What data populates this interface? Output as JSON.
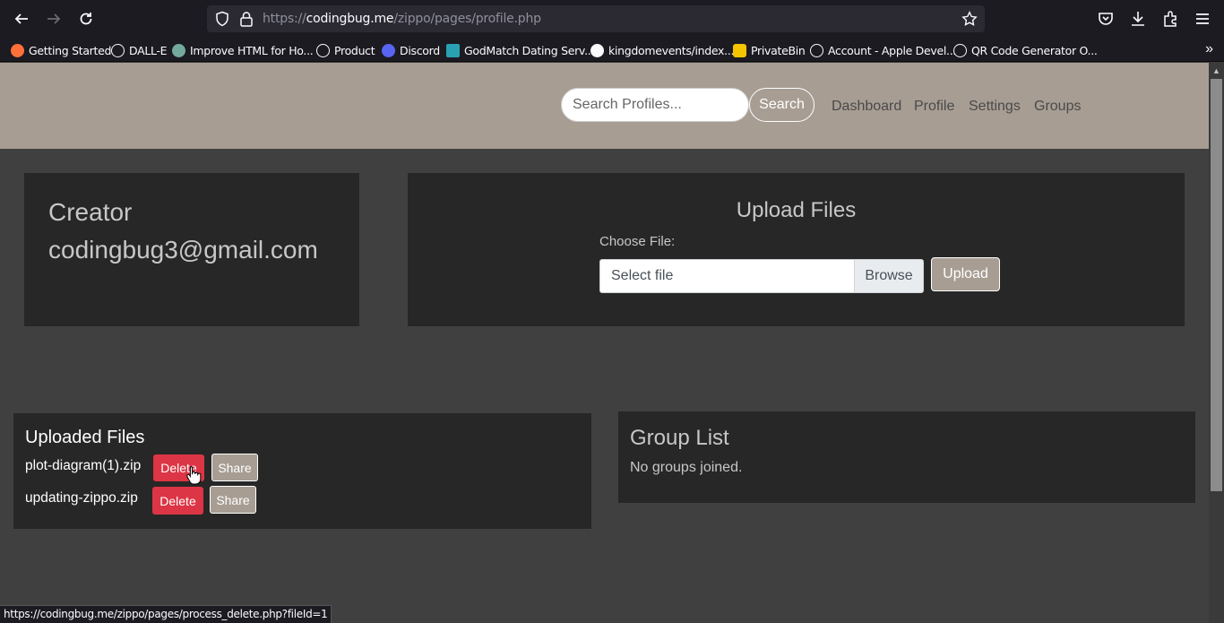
{
  "browser": {
    "url_prefix": "https://",
    "url_host": "codingbug.me",
    "url_path": "/zippo/pages/profile.php",
    "status_url": "https://codingbug.me/zippo/pages/process_delete.php?fileId=1",
    "bookmarks": [
      {
        "label": "Getting Started",
        "icon": "firefox-icon"
      },
      {
        "label": "DALL-E",
        "icon": "globe-icon"
      },
      {
        "label": "Improve HTML for Ho...",
        "icon": "chatgpt-icon"
      },
      {
        "label": "Product",
        "icon": "globe-icon"
      },
      {
        "label": "Discord",
        "icon": "discord-icon"
      },
      {
        "label": "GodMatch Dating Serv...",
        "icon": "godmatch-icon"
      },
      {
        "label": "kingdomevents/index....",
        "icon": "github-icon"
      },
      {
        "label": "PrivateBin",
        "icon": "privatebin-icon"
      },
      {
        "label": "Account - Apple Devel...",
        "icon": "globe-icon"
      },
      {
        "label": "QR Code Generator O...",
        "icon": "globe-icon"
      }
    ]
  },
  "header": {
    "search_placeholder": "Search Profiles...",
    "search_button": "Search",
    "nav": [
      "Dashboard",
      "Profile",
      "Settings",
      "Groups"
    ]
  },
  "profile": {
    "role": "Creator",
    "email": "codingbug3@gmail.com"
  },
  "upload": {
    "title": "Upload Files",
    "choose_label": "Choose File:",
    "file_placeholder": "Select file",
    "browse_label": "Browse",
    "upload_button": "Upload"
  },
  "uploaded_files": {
    "title": "Uploaded Files",
    "delete_label": "Delete",
    "share_label": "Share",
    "files": [
      "plot-diagram(1).zip",
      "updating-zippo.zip"
    ]
  },
  "groups": {
    "title": "Group List",
    "empty_text": "No groups joined."
  }
}
